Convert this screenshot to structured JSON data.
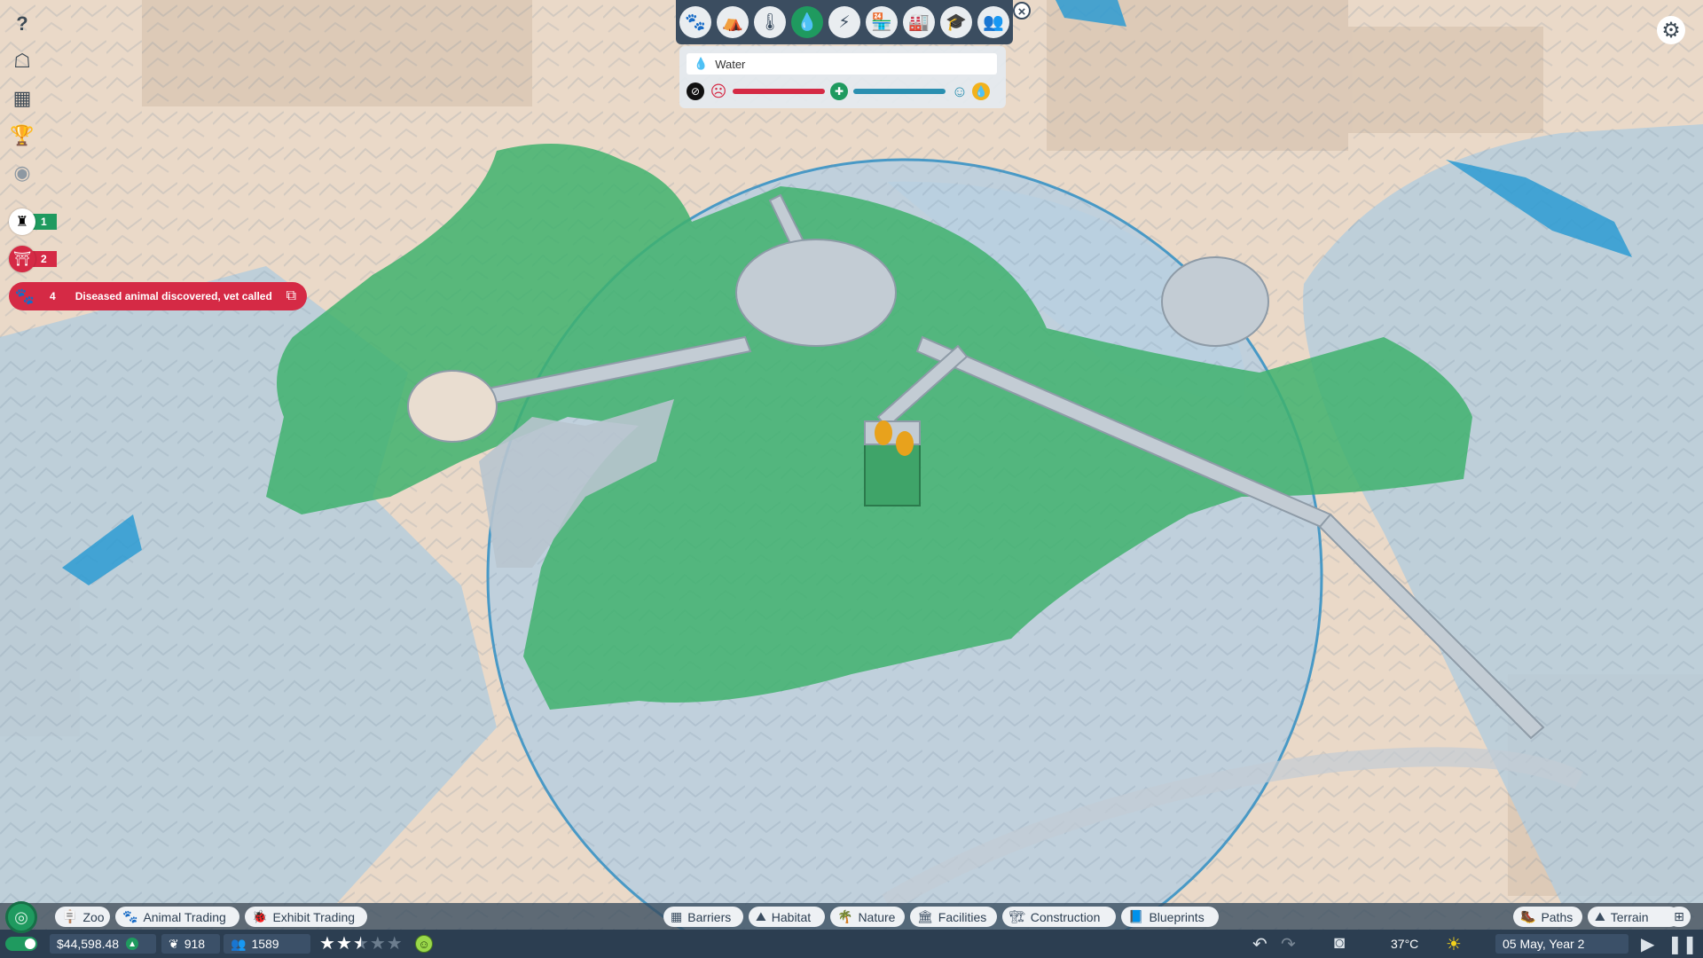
{
  "heatmap": {
    "buttons": [
      {
        "name": "animal-paw-icon",
        "glyph": "🐾",
        "active": false
      },
      {
        "name": "guest-bench-icon",
        "glyph": "⛺",
        "active": false
      },
      {
        "name": "temperature-icon",
        "glyph": "🌡",
        "active": false
      },
      {
        "name": "water-drop-icon",
        "glyph": "💧",
        "active": true
      },
      {
        "name": "power-bolt-icon",
        "glyph": "⚡",
        "active": false
      },
      {
        "name": "shop-icon",
        "glyph": "🏪",
        "active": false
      },
      {
        "name": "facility-icon",
        "glyph": "🏭",
        "active": false
      },
      {
        "name": "education-icon",
        "glyph": "🎓",
        "active": false
      },
      {
        "name": "staff-group-icon",
        "glyph": "👥",
        "active": false
      }
    ],
    "title": "Water",
    "legend": {
      "low_color": "#d52a45",
      "mid_color": "#1f9a5f",
      "high_color": "#2a8fb0"
    }
  },
  "alerts": [
    {
      "icon": "trophy-animal-icon",
      "count": "1",
      "style": "green"
    },
    {
      "icon": "habitat-gate-icon",
      "count": "2",
      "style": "red"
    }
  ],
  "notification": {
    "count": "4",
    "message": "Diseased animal discovered, vet called"
  },
  "bottom_tabs_left": [
    {
      "name": "tab-zoo",
      "icon": "zoo-sign-icon",
      "glyph": "🪧",
      "label": "Zoo"
    },
    {
      "name": "tab-animal-trading",
      "icon": "paw-icon",
      "glyph": "🐾",
      "label": "Animal Trading"
    },
    {
      "name": "tab-exhibit-trading",
      "icon": "bug-icon",
      "glyph": "🐞",
      "label": "Exhibit Trading"
    }
  ],
  "bottom_tabs_center": [
    {
      "name": "tab-barriers",
      "icon": "fence-icon",
      "glyph": "▦",
      "label": "Barriers"
    },
    {
      "name": "tab-habitat",
      "icon": "habitat-icon",
      "glyph": "⛰",
      "label": "Habitat"
    },
    {
      "name": "tab-nature",
      "icon": "palm-tree-icon",
      "glyph": "🌴",
      "label": "Nature"
    },
    {
      "name": "tab-facilities",
      "icon": "building-icon",
      "glyph": "🏛",
      "label": "Facilities"
    },
    {
      "name": "tab-construction",
      "icon": "crane-icon",
      "glyph": "🏗",
      "label": "Construction"
    },
    {
      "name": "tab-blueprints",
      "icon": "blueprint-icon",
      "glyph": "📘",
      "label": "Blueprints"
    }
  ],
  "bottom_tabs_right": [
    {
      "name": "tab-paths",
      "icon": "path-icon",
      "glyph": "🥾",
      "label": "Paths"
    },
    {
      "name": "tab-terrain",
      "icon": "mountain-icon",
      "glyph": "⛰",
      "label": "Terrain"
    }
  ],
  "status": {
    "money": "$44,598.48",
    "conservation": "918",
    "guests": "1589",
    "rating_stars": 2.5,
    "temperature": "37°C",
    "date": "05 May, Year 2"
  }
}
